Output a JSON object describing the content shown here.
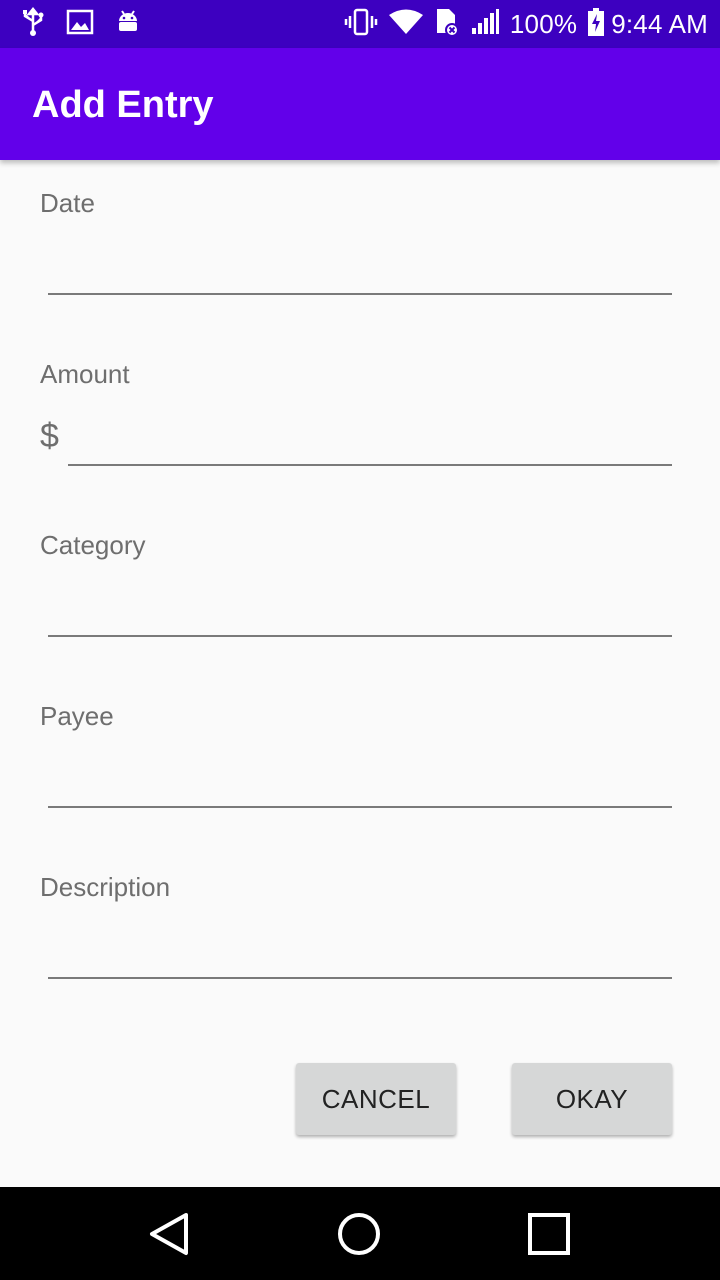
{
  "status_bar": {
    "battery": "100%",
    "time": "9:44 AM",
    "icons": [
      "usb-icon",
      "image-icon",
      "android-icon",
      "vibrate-icon",
      "wifi-icon",
      "sim-error-icon",
      "signal-icon",
      "battery-charging-icon"
    ]
  },
  "app_bar": {
    "title": "Add Entry",
    "color": "#6200ea"
  },
  "form": {
    "date": {
      "label": "Date",
      "value": ""
    },
    "amount": {
      "label": "Amount",
      "currency": "$",
      "value": ""
    },
    "category": {
      "label": "Category",
      "value": ""
    },
    "payee": {
      "label": "Payee",
      "value": ""
    },
    "description": {
      "label": "Description",
      "value": ""
    }
  },
  "actions": {
    "cancel_label": "CANCEL",
    "okay_label": "OKAY"
  },
  "nav_bar": {
    "icons": [
      "back-icon",
      "home-icon",
      "recents-icon"
    ]
  }
}
